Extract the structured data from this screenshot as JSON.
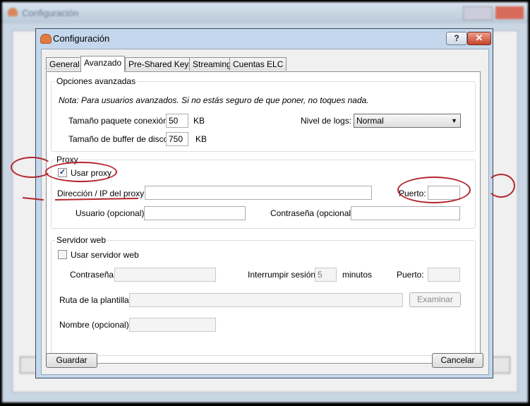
{
  "background_window": {
    "title": "Configuración"
  },
  "window": {
    "title": "Configuración",
    "help_label": "?",
    "close_label": "✕"
  },
  "tabs": [
    {
      "label": "General"
    },
    {
      "label": "Avanzado"
    },
    {
      "label": "Pre-Shared Keys"
    },
    {
      "label": "Streaming"
    },
    {
      "label": "Cuentas ELC"
    }
  ],
  "advanced": {
    "title": "Opciones avanzadas",
    "note": "Nota: Para usuarios avanzados. Si no estás seguro de que poner, no toques nada.",
    "packet_size_label": "Tamaño paquete conexión:",
    "packet_size_value": "50",
    "packet_size_unit": "KB",
    "buffer_label": "Tamaño de buffer de disco:",
    "buffer_value": "750",
    "buffer_unit": "KB",
    "log_level_label": "Nivel de logs:",
    "log_level_value": "Normal"
  },
  "proxy": {
    "title": "Proxy",
    "use_proxy_label": "Usar proxy",
    "use_proxy_checked": true,
    "address_label": "Dirección / IP del proxy:",
    "address_value": "",
    "port_label": "Puerto:",
    "port_value": "",
    "user_label": "Usuario (opcional):",
    "user_value": "",
    "password_label": "Contraseña (opcional):",
    "password_value": ""
  },
  "webserver": {
    "title": "Servidor web",
    "use_label": "Usar servidor web",
    "use_checked": false,
    "password_label": "Contraseña:",
    "password_value": "",
    "timeout_label": "Interrumpir sesión:",
    "timeout_value": "5",
    "timeout_unit": "minutos",
    "port_label": "Puerto:",
    "port_value": "",
    "template_label": "Ruta de la plantilla:",
    "template_value": "",
    "browse_label": "Examinar",
    "name_label": "Nombre (opcional):",
    "name_value": ""
  },
  "buttons": {
    "save_label": "Guardar",
    "cancel_label": "Cancelar"
  },
  "colors": {
    "annotation": "#b3262c",
    "titlebar": "#c4d7ec",
    "close": "#c7432a"
  }
}
